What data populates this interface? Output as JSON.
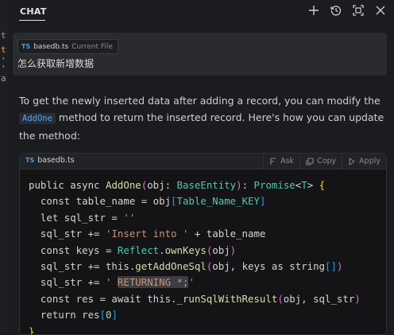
{
  "left_strip": {
    "glyphs": [
      "t",
      "t",
      "'",
      "'",
      "a"
    ]
  },
  "header": {
    "tab_label": "CHAT",
    "icons": [
      "plus-icon",
      "history-icon",
      "maximize-icon",
      "close-icon"
    ]
  },
  "user_message": {
    "file_chip": {
      "badge": "TS",
      "file_name": "basedb.ts",
      "tag": "Current File"
    },
    "text": "怎么获取新增数据"
  },
  "answer": {
    "text_before": "To get the newly inserted data after adding a record, you can modify the",
    "inline_code": "AddOne",
    "text_after": "method to return the inserted record. Here's how you can update the method:"
  },
  "code_block": {
    "badge": "TS",
    "file_name": "basedb.ts",
    "actions": {
      "ask": "Ask",
      "copy": "Copy",
      "apply": "Apply"
    },
    "lines": [
      "public async AddOne(obj: BaseEntity): Promise<T> {",
      "  const table_name = obj[Table_Name_KEY]",
      "  let sql_str = ''",
      "  sql_str += 'Insert into ' + table_name",
      "  const keys = Reflect.ownKeys(obj)",
      "  sql_str += this.getAddOneSql(obj, keys as string[])",
      "  sql_str += ' RETURNING *;'",
      "  const res = await this._runSqlWithResult(obj, sql_str)",
      "  return res[0]",
      "}"
    ]
  },
  "colors": {
    "background": "#1b1c1f",
    "user_bubble": "#2a2b2e",
    "inline_code": "#4ea1f3",
    "ts_badge": "#4b9be3",
    "string": "#ce9178",
    "function": "#dcdcaa",
    "type": "#4ec9b0",
    "number": "#b5cea8"
  }
}
